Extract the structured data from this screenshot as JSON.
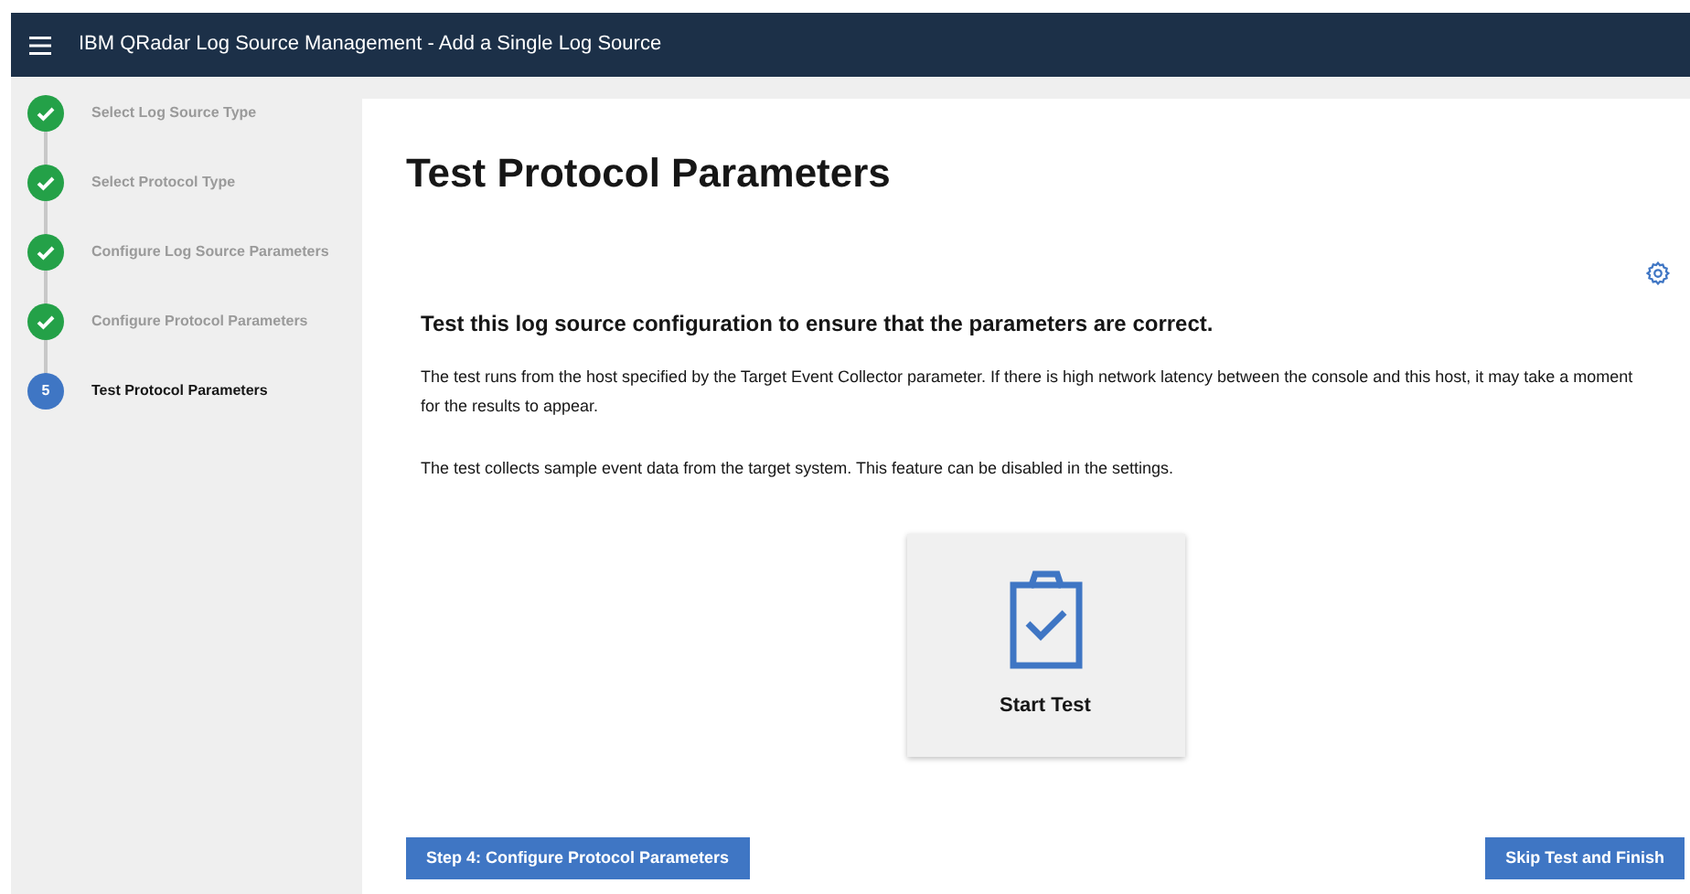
{
  "header": {
    "title": "IBM QRadar Log Source Management - Add a Single Log Source"
  },
  "steps": [
    {
      "label": "Select Log Source Type",
      "done": true
    },
    {
      "label": "Select Protocol Type",
      "done": true
    },
    {
      "label": "Configure Log Source Parameters",
      "done": true
    },
    {
      "label": "Configure Protocol Parameters",
      "done": true
    },
    {
      "label": "Test Protocol Parameters",
      "done": false,
      "number": "5"
    }
  ],
  "main": {
    "title": "Test Protocol Parameters",
    "subtitle": "Test this log source configuration to ensure that the parameters are correct.",
    "paragraphs": [
      "The test runs from the host specified by the Target Event Collector parameter. If there is high network latency between the console and this host, it may take a moment for the results to appear.",
      "The test collects sample event data from the target system. This feature can be disabled in the settings."
    ],
    "start_button": "Start Test"
  },
  "footer": {
    "back_button": "Step 4: Configure Protocol Parameters",
    "finish_button": "Skip Test and Finish"
  }
}
